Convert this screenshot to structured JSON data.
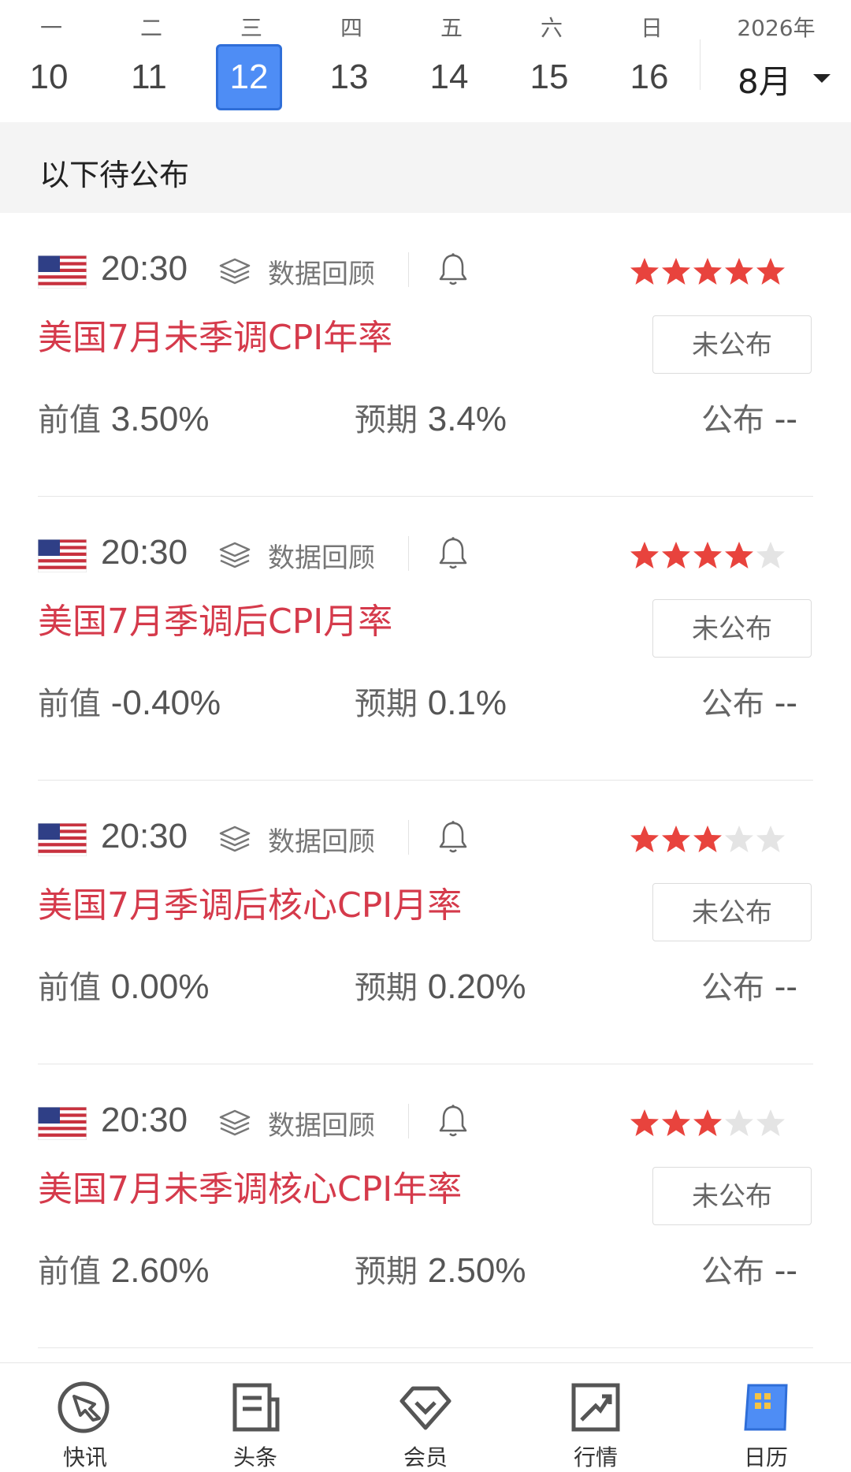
{
  "calendar": {
    "days": [
      {
        "weekday": "一",
        "date": "10"
      },
      {
        "weekday": "二",
        "date": "11"
      },
      {
        "weekday": "三",
        "date": "12"
      },
      {
        "weekday": "四",
        "date": "13"
      },
      {
        "weekday": "五",
        "date": "14"
      },
      {
        "weekday": "六",
        "date": "15"
      },
      {
        "weekday": "日",
        "date": "16"
      }
    ],
    "selected_date": "12",
    "year": "2026年",
    "month": "8月"
  },
  "section": {
    "title": "以下待公布"
  },
  "events": [
    {
      "time": "20:30",
      "review_label": "数据回顾",
      "title": "美国7月未季调CPI年率",
      "stars": 5,
      "status": "未公布",
      "prev_label": "前值",
      "prev": "3.50%",
      "exp_label": "预期",
      "exp": "3.4%",
      "act_label": "公布",
      "act": "--"
    },
    {
      "time": "20:30",
      "review_label": "数据回顾",
      "title": "美国7月季调后CPI月率",
      "stars": 4,
      "status": "未公布",
      "prev_label": "前值",
      "prev": "-0.40%",
      "exp_label": "预期",
      "exp": "0.1%",
      "act_label": "公布",
      "act": "--"
    },
    {
      "time": "20:30",
      "review_label": "数据回顾",
      "title": "美国7月季调后核心CPI月率",
      "stars": 3,
      "status": "未公布",
      "prev_label": "前值",
      "prev": "0.00%",
      "exp_label": "预期",
      "exp": "0.20%",
      "act_label": "公布",
      "act": "--"
    },
    {
      "time": "20:30",
      "review_label": "数据回顾",
      "title": "美国7月未季调核心CPI年率",
      "stars": 3,
      "status": "未公布",
      "prev_label": "前值",
      "prev": "2.60%",
      "exp_label": "预期",
      "exp": "2.50%",
      "act_label": "公布",
      "act": "--"
    }
  ],
  "colors": {
    "accent": "#4e8df5",
    "title_red": "#d53a4b",
    "star_on": "#e8433d",
    "star_off": "#e4e4e4"
  },
  "bottom_nav": [
    {
      "label": "快讯",
      "icon": "compass-icon"
    },
    {
      "label": "头条",
      "icon": "newspaper-icon"
    },
    {
      "label": "会员",
      "icon": "diamond-icon"
    },
    {
      "label": "行情",
      "icon": "chart-trend-icon"
    },
    {
      "label": "日历",
      "icon": "calendar-icon"
    }
  ]
}
